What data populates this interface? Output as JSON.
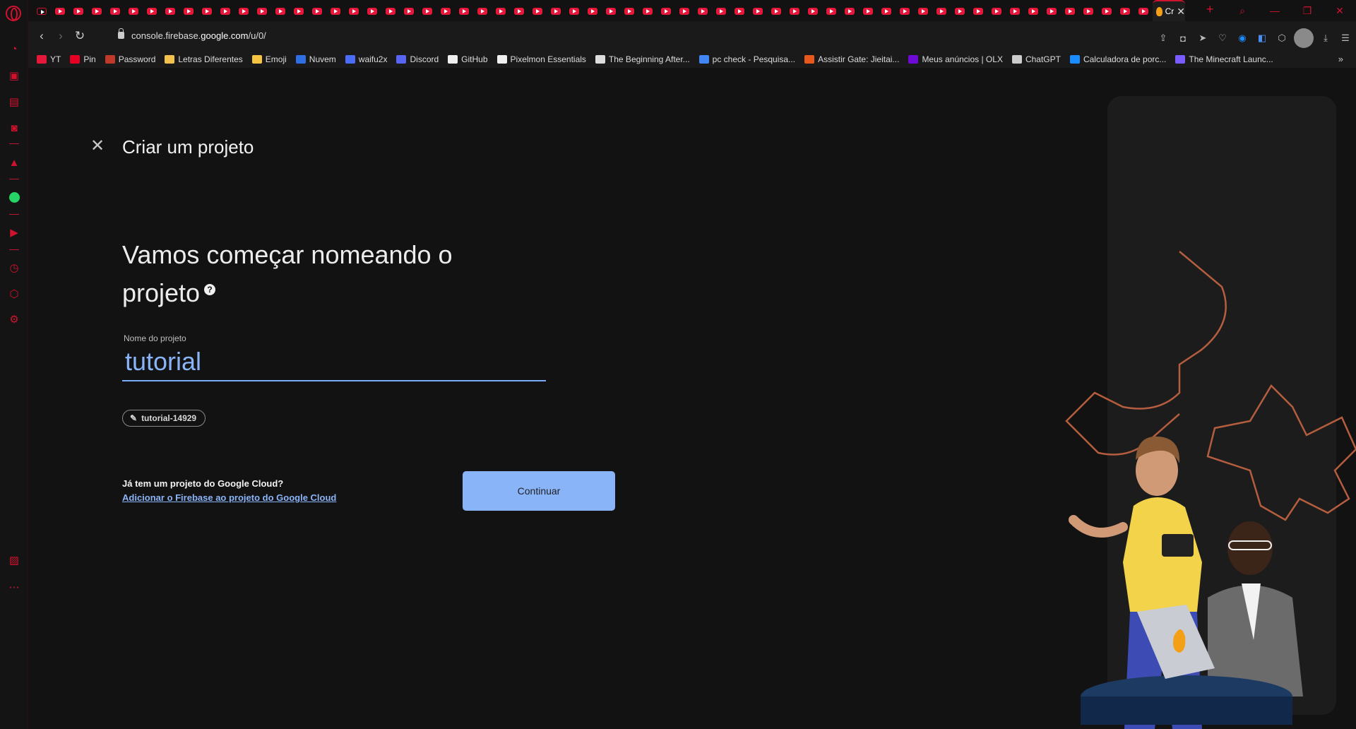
{
  "tabs": {
    "youtube_tab_count": 61,
    "active_tab_title": "Cr"
  },
  "address_bar": {
    "url_prefix": "console.firebase.",
    "url_domain": "google.com",
    "url_path": "/u/0/"
  },
  "bookmarks": [
    {
      "label": "YT",
      "icon": "youtube-icon",
      "color": "#e5173a"
    },
    {
      "label": "Pin",
      "icon": "pinterest-icon",
      "color": "#e60023"
    },
    {
      "label": "Password",
      "icon": "password-icon",
      "color": "#c0392b"
    },
    {
      "label": "Letras Diferentes",
      "icon": "note-icon",
      "color": "#f2c14e"
    },
    {
      "label": "Emoji",
      "icon": "emoji-icon",
      "color": "#f5c542"
    },
    {
      "label": "Nuvem",
      "icon": "dropbox-icon",
      "color": "#2f6fe4"
    },
    {
      "label": "waifu2x",
      "icon": "waifu-icon",
      "color": "#4a6cf7"
    },
    {
      "label": "Discord",
      "icon": "discord-icon",
      "color": "#5865f2"
    },
    {
      "label": "GitHub",
      "icon": "github-icon",
      "color": "#f0f0f0"
    },
    {
      "label": "Pixelmon Essentials",
      "icon": "page-icon",
      "color": "#f0f0f0"
    },
    {
      "label": "The Beginning After...",
      "icon": "book-icon",
      "color": "#dddddd"
    },
    {
      "label": "pc check - Pesquisa...",
      "icon": "google-icon",
      "color": "#4285f4"
    },
    {
      "label": "Assistir Gate: Jieitai...",
      "icon": "anime-icon",
      "color": "#e8581c"
    },
    {
      "label": "Meus anúncios | OLX",
      "icon": "olx-icon",
      "color": "#6e0ad6"
    },
    {
      "label": "ChatGPT",
      "icon": "chatgpt-icon",
      "color": "#cccccc"
    },
    {
      "label": "Calculadora de porc...",
      "icon": "calculator-icon",
      "color": "#1a8cff"
    },
    {
      "label": "The Minecraft Launc...",
      "icon": "minecraft-icon",
      "color": "#7a5cff"
    }
  ],
  "page": {
    "dialog_title": "Criar um projeto",
    "heading": "Vamos começar nomeando o projeto",
    "help_symbol": "?",
    "field_label": "Nome do projeto",
    "project_name_value": "tutorial",
    "project_id": "tutorial-14929",
    "gc_question": "Já tem um projeto do Google Cloud?",
    "gc_link": "Adicionar o Firebase ao projeto do Google Cloud",
    "continue_label": "Continuar"
  },
  "colors": {
    "accent_red": "#d1122f",
    "firebase_blue": "#8ab4f8",
    "background": "#121212"
  }
}
